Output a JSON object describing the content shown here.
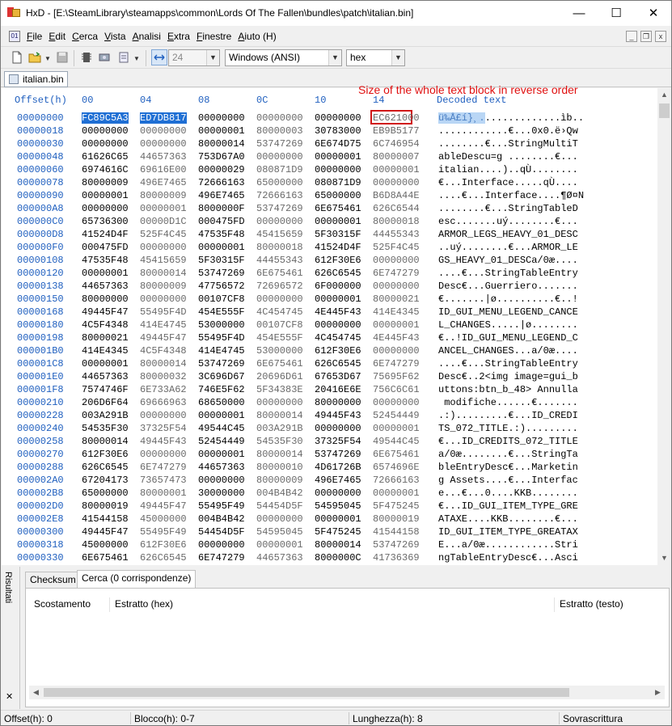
{
  "window": {
    "title": "HxD - [E:\\SteamLibrary\\steamapps\\common\\Lords Of The Fallen\\bundles\\patch\\italian.bin]",
    "min": "—",
    "max": "☐",
    "close": "✕"
  },
  "menu": {
    "items": [
      "File",
      "Edit",
      "Cerca",
      "Vista",
      "Analisi",
      "Extra",
      "Finestre",
      "Aiuto (H)"
    ]
  },
  "toolbar": {
    "bytes_per_row": "24",
    "charset": "Windows (ANSI)",
    "offset_base": "hex"
  },
  "doc_tab": {
    "label": "italian.bin"
  },
  "hex_view": {
    "header": {
      "offset": "Offset(h)",
      "cols": [
        "00",
        "04",
        "08",
        "0C",
        "10",
        "14"
      ],
      "decoded": "Decoded text"
    },
    "annotation": "Size of the whole text block in reverse order",
    "rows": [
      {
        "off": "00000000",
        "g": [
          "FC89C5A3",
          "ED7DB817",
          "00000000",
          "00000000",
          "00000000",
          "EC621000"
        ],
        "t": "ü‰Å£í}¸..............ìb.."
      },
      {
        "off": "00000018",
        "g": [
          "00000000",
          "00000000",
          "00000001",
          "80000003",
          "30783000",
          "EB9B5177"
        ],
        "t": "............€...0x0.ë›Qw"
      },
      {
        "off": "00000030",
        "g": [
          "00000000",
          "00000000",
          "80000014",
          "53747269",
          "6E674D75",
          "6C746954"
        ],
        "t": "........€...StringMultiT"
      },
      {
        "off": "00000048",
        "g": [
          "61626C65",
          "44657363",
          "753D67A0",
          "00000000",
          "00000001",
          "80000007"
        ],
        "t": "ableDescu=g ........€..."
      },
      {
        "off": "00000060",
        "g": [
          "6974616C",
          "69616E00",
          "00000029",
          "080871D9",
          "00000000",
          "00000001"
        ],
        "t": "italian....)..qÙ........"
      },
      {
        "off": "00000078",
        "g": [
          "80000009",
          "496E7465",
          "72666163",
          "65000000",
          "080871D9",
          "00000000"
        ],
        "t": "€...Interface.....qÙ...."
      },
      {
        "off": "00000090",
        "g": [
          "00000001",
          "80000009",
          "496E7465",
          "72666163",
          "65000000",
          "B6D8A44E"
        ],
        "t": "....€...Interface....¶Ø¤N"
      },
      {
        "off": "000000A8",
        "g": [
          "00000000",
          "00000001",
          "8000000F",
          "53747269",
          "6E675461",
          "626C6544"
        ],
        "t": "........€...StringTableD"
      },
      {
        "off": "000000C0",
        "g": [
          "65736300",
          "00000D1C",
          "000475FD",
          "00000000",
          "00000001",
          "80000018"
        ],
        "t": "esc.......uý........€..."
      },
      {
        "off": "000000D8",
        "g": [
          "41524D4F",
          "525F4C45",
          "47535F48",
          "45415659",
          "5F30315F",
          "44455343"
        ],
        "t": "ARMOR_LEGS_HEAVY_01_DESC"
      },
      {
        "off": "000000F0",
        "g": [
          "000475FD",
          "00000000",
          "00000001",
          "80000018",
          "41524D4F",
          "525F4C45"
        ],
        "t": "..uý........€...ARMOR_LE"
      },
      {
        "off": "00000108",
        "g": [
          "47535F48",
          "45415659",
          "5F30315F",
          "44455343",
          "612F30E6",
          "00000000"
        ],
        "t": "GS_HEAVY_01_DESCa/0æ...."
      },
      {
        "off": "00000120",
        "g": [
          "00000001",
          "80000014",
          "53747269",
          "6E675461",
          "626C6545",
          "6E747279"
        ],
        "t": "....€...StringTableEntry"
      },
      {
        "off": "00000138",
        "g": [
          "44657363",
          "80000009",
          "47756572",
          "72696572",
          "6F000000",
          "00000000"
        ],
        "t": "Desc€...Guerriero......."
      },
      {
        "off": "00000150",
        "g": [
          "80000000",
          "00000000",
          "00107CF8",
          "00000000",
          "00000001",
          "80000021"
        ],
        "t": "€.......|ø..........€..!"
      },
      {
        "off": "00000168",
        "g": [
          "49445F47",
          "55495F4D",
          "454E555F",
          "4C454745",
          "4E445F43",
          "414E4345"
        ],
        "t": "ID_GUI_MENU_LEGEND_CANCE"
      },
      {
        "off": "00000180",
        "g": [
          "4C5F4348",
          "414E4745",
          "53000000",
          "00107CF8",
          "00000000",
          "00000001"
        ],
        "t": "L_CHANGES.....|ø........"
      },
      {
        "off": "00000198",
        "g": [
          "80000021",
          "49445F47",
          "55495F4D",
          "454E555F",
          "4C454745",
          "4E445F43"
        ],
        "t": "€..!ID_GUI_MENU_LEGEND_C"
      },
      {
        "off": "000001B0",
        "g": [
          "414E4345",
          "4C5F4348",
          "414E4745",
          "53000000",
          "612F30E6",
          "00000000"
        ],
        "t": "ANCEL_CHANGES...a/0æ...."
      },
      {
        "off": "000001C8",
        "g": [
          "00000001",
          "80000014",
          "53747269",
          "6E675461",
          "626C6545",
          "6E747279"
        ],
        "t": "....€...StringTableEntry"
      },
      {
        "off": "000001E0",
        "g": [
          "44657363",
          "80000032",
          "3C696D67",
          "20696D61",
          "67653D67",
          "75695F62"
        ],
        "t": "Desc€..2<img image=gui_b"
      },
      {
        "off": "000001F8",
        "g": [
          "7574746F",
          "6E733A62",
          "746E5F62",
          "5F34383E",
          "20416E6E",
          "756C6C61"
        ],
        "t": "uttons:btn_b_48> Annulla"
      },
      {
        "off": "00000210",
        "g": [
          "206D6F64",
          "69666963",
          "68650000",
          "00000000",
          "80000000",
          "00000000"
        ],
        "t": " modifiche......€......."
      },
      {
        "off": "00000228",
        "g": [
          "003A291B",
          "00000000",
          "00000001",
          "80000014",
          "49445F43",
          "52454449"
        ],
        "t": ".:).........€...ID_CREDI"
      },
      {
        "off": "00000240",
        "g": [
          "54535F30",
          "37325F54",
          "49544C45",
          "003A291B",
          "00000000",
          "00000001"
        ],
        "t": "TS_072_TITLE.:)........."
      },
      {
        "off": "00000258",
        "g": [
          "80000014",
          "49445F43",
          "52454449",
          "54535F30",
          "37325F54",
          "49544C45"
        ],
        "t": "€...ID_CREDITS_072_TITLE"
      },
      {
        "off": "00000270",
        "g": [
          "612F30E6",
          "00000000",
          "00000001",
          "80000014",
          "53747269",
          "6E675461"
        ],
        "t": "a/0æ........€...StringTa"
      },
      {
        "off": "00000288",
        "g": [
          "626C6545",
          "6E747279",
          "44657363",
          "80000010",
          "4D61726B",
          "6574696E"
        ],
        "t": "bleEntryDesc€...Marketin"
      },
      {
        "off": "000002A0",
        "g": [
          "67204173",
          "73657473",
          "00000000",
          "80000009",
          "496E7465",
          "72666163"
        ],
        "t": "g Assets....€...Interfac"
      },
      {
        "off": "000002B8",
        "g": [
          "65000000",
          "80000001",
          "30000000",
          "004B4B42",
          "00000000",
          "00000001"
        ],
        "t": "e...€...0....KKB........"
      },
      {
        "off": "000002D0",
        "g": [
          "80000019",
          "49445F47",
          "55495F49",
          "54454D5F",
          "54595045",
          "5F475245"
        ],
        "t": "€...ID_GUI_ITEM_TYPE_GRE"
      },
      {
        "off": "000002E8",
        "g": [
          "41544158",
          "45000000",
          "004B4B42",
          "00000000",
          "00000001",
          "80000019"
        ],
        "t": "ATAXE....KKB........€..."
      },
      {
        "off": "00000300",
        "g": [
          "49445F47",
          "55495F49",
          "54454D5F",
          "54595045",
          "5F475245",
          "41544158"
        ],
        "t": "ID_GUI_ITEM_TYPE_GREATAX"
      },
      {
        "off": "00000318",
        "g": [
          "45000000",
          "612F30E6",
          "00000000",
          "00000001",
          "80000014",
          "53747269"
        ],
        "t": "E...a/0æ............Stri"
      },
      {
        "off": "00000330",
        "g": [
          "6E675461",
          "626C6545",
          "6E747279",
          "44657363",
          "8000000C",
          "41736369"
        ],
        "t": "ngTableEntryDesc€...Asci"
      }
    ]
  },
  "results": {
    "side_label": "Risultati",
    "close": "✕",
    "tabs": [
      "Checksum",
      "Cerca (0 corrispondenze)"
    ],
    "columns": [
      "Scostamento",
      "Estratto (hex)",
      "Estratto (testo)"
    ]
  },
  "status": {
    "offset": "Offset(h): 0",
    "block": "Blocco(h): 0-7",
    "length": "Lunghezza(h): 8",
    "mode": "Sovrascrittura"
  }
}
